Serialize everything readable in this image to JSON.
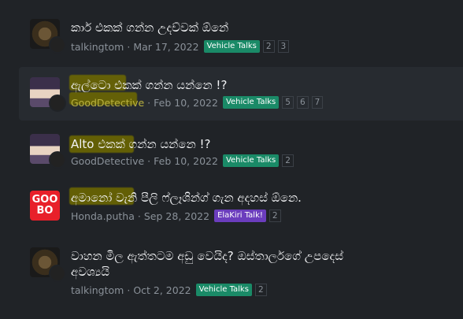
{
  "threads": [
    {
      "title": "කාර් එකක් ගන්න උදව්වක් ඕනේ",
      "user": "talkingtom",
      "date": "Mar 17, 2022",
      "tag": "Vehicle Talks",
      "pages": [
        "2",
        "3"
      ]
    },
    {
      "title": "ඇල්ටො එකක් ගන්න යන්නෙ !?",
      "user": "GoodDetective",
      "date": "Feb 10, 2022",
      "tag": "Vehicle Talks",
      "pages": [
        "5",
        "6",
        "7"
      ]
    },
    {
      "title": "Alto එකක් ගන්න යන්නෙ !?",
      "user": "GoodDetective",
      "date": "Feb 10, 2022",
      "tag": "Vehicle Talks",
      "pages": [
        "2"
      ]
    },
    {
      "title": "අමානෝ වැනි පීලි ෆ්ලෑශින්ග් ගැන අදහස් ඕනෙ.",
      "user": "Honda.putha",
      "date": "Sep 28, 2022",
      "tag": "ElaKiri Talk!",
      "pages": [
        "2"
      ]
    },
    {
      "title_line1": "වාහන මිල ඇත්තටම අඩු වෙයිද? ඔස්තාර්ලගේ උපදෙස්",
      "title_line2": "අවශ්‍යයි",
      "user": "talkingtom",
      "date": "Oct 2, 2022",
      "tag": "Vehicle Talks",
      "pages": [
        "2"
      ]
    }
  ],
  "avatar_text": {
    "top": "GOO",
    "bottom": "BO"
  },
  "colors": {
    "background": "#202327",
    "highlight_row": "#272b30",
    "tag_green": "#1a8a67",
    "tag_purple": "#6b3dbd",
    "marker_yellow": "#6f6a00"
  }
}
